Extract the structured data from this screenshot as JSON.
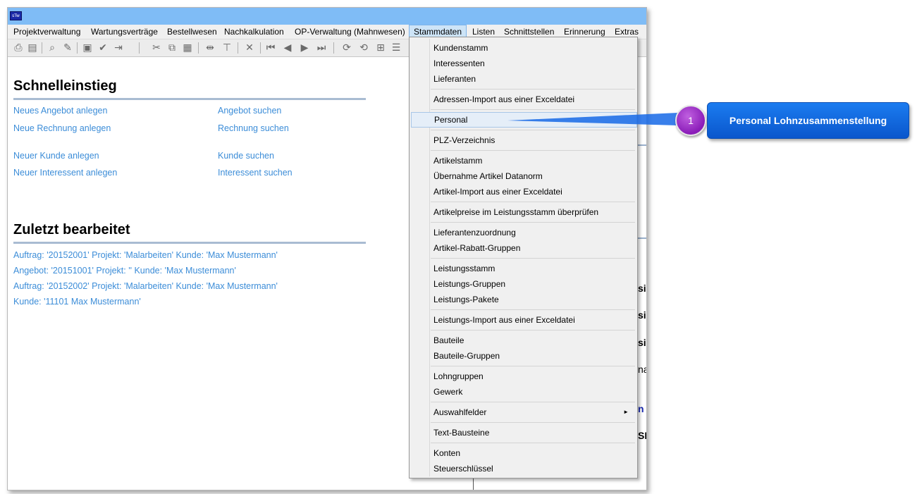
{
  "menubar": {
    "items": [
      "Projektverwaltung",
      "Wartungsverträge",
      "Bestellwesen",
      "Nachkalkulation",
      "OP-Verwaltung (Mahnwesen)",
      "Stammdaten",
      "Listen",
      "Schnittstellen",
      "Erinnerung",
      "Extras"
    ],
    "active": "Stammdaten"
  },
  "quick": {
    "title": "Schnelleinstieg",
    "links_left": [
      "Neues Angebot anlegen",
      "Neue Rechnung anlegen",
      "Neuer Kunde anlegen",
      "Neuer Interessent anlegen"
    ],
    "links_right": [
      "Angebot suchen",
      "Rechnung suchen",
      "Kunde suchen",
      "Interessent suchen"
    ]
  },
  "recent": {
    "title": "Zuletzt bearbeitet",
    "items": [
      "Auftrag: '20152001' Projekt: 'Malarbeiten' Kunde: 'Max Mustermann'",
      "Angebot: '20151001' Projekt: '' Kunde: 'Max Mustermann'",
      "Auftrag: '20152002' Projekt: 'Malarbeiten' Kunde: 'Max Mustermann'",
      "Kunde: '11101 Max Mustermann'"
    ]
  },
  "right_pane": {
    "fragments": [
      "si",
      "si",
      "si",
      "na",
      "n",
      "SE"
    ]
  },
  "dropdown": {
    "items": [
      "Kundenstamm",
      "Interessenten",
      "Lieferanten",
      "Adressen-Import aus einer Exceldatei",
      "Personal",
      "PLZ-Verzeichnis",
      "Artikelstamm",
      "Übernahme Artikel Datanorm",
      "Artikel-Import aus einer Exceldatei",
      "Artikelpreise im Leistungsstamm überprüfen",
      "Lieferantenzuordnung",
      "Artikel-Rabatt-Gruppen",
      "Leistungsstamm",
      "Leistungs-Gruppen",
      "Leistungs-Pakete",
      "Leistungs-Import aus einer Exceldatei",
      "Bauteile",
      "Bauteile-Gruppen",
      "Lohngruppen",
      "Gewerk",
      "Auswahlfelder",
      "Text-Bausteine",
      "Konten",
      "Steuerschlüssel"
    ],
    "highlighted": "Personal",
    "submenu_arrow": "►"
  },
  "callout": {
    "number": "1",
    "text": "Personal Lohnzusammenstellung",
    "icon": "callout-pointer-icon"
  },
  "app_icon": {
    "name": "app-logo-icon",
    "text": "sTw"
  },
  "toolbar_icons": [
    "print-icon",
    "print-preview-icon",
    "search-icon",
    "edit-icon",
    "save-icon",
    "check-icon",
    "export-icon",
    "cut-icon",
    "copy-icon",
    "paste-icon",
    "insert-column-icon",
    "insert-row-icon",
    "delete-icon",
    "first-record-icon",
    "previous-record-icon",
    "next-record-icon",
    "last-record-icon",
    "refresh-icon",
    "sync-icon",
    "window-icon",
    "list-icon"
  ]
}
